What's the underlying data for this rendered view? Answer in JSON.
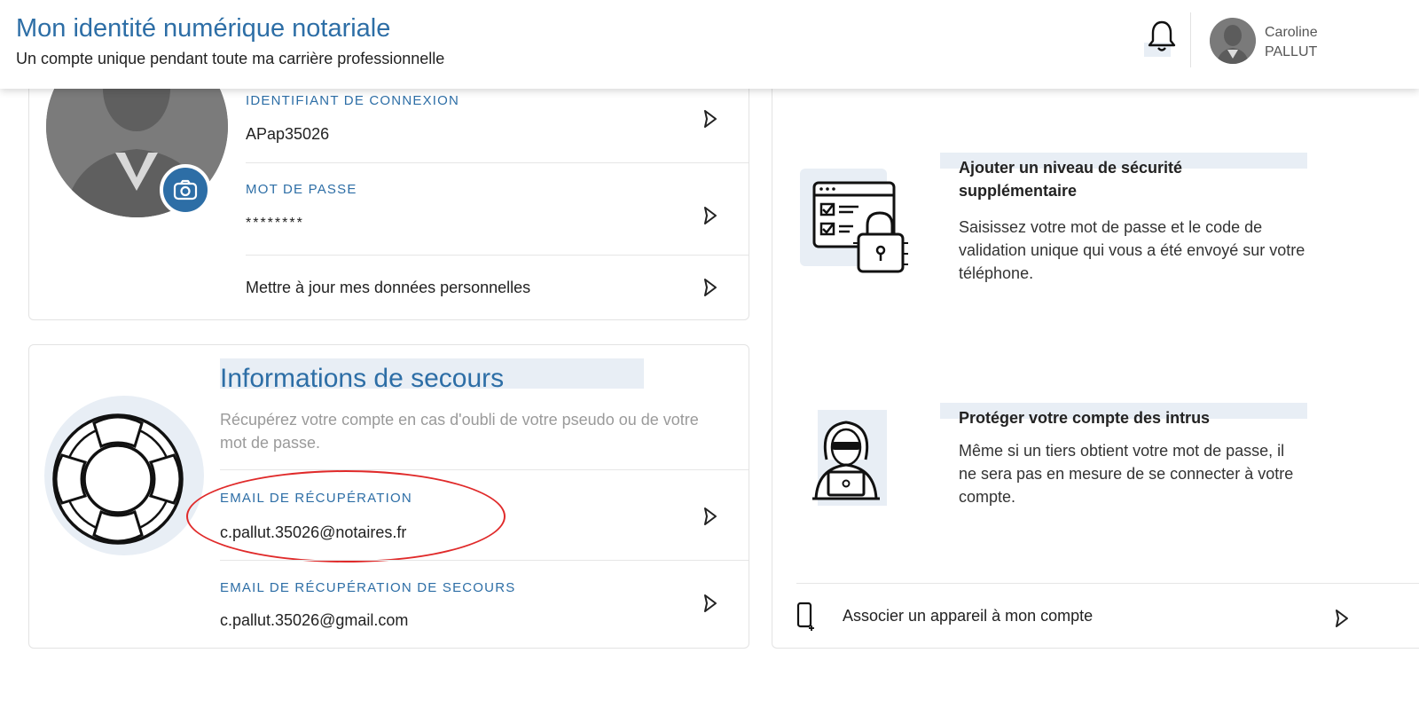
{
  "header": {
    "title": "Mon identité numérique notariale",
    "subtitle": "Un compte unique pendant toute ma carrière professionnelle",
    "user_first_name": "Caroline",
    "user_last_name": "PALLUT"
  },
  "account": {
    "login_label": "IDENTIFIANT DE CONNEXION",
    "login_value": "APap35026",
    "password_label": "MOT DE PASSE",
    "password_value": "********",
    "update_label": "Mettre à jour mes données personnelles"
  },
  "rescue": {
    "title": "Informations de secours",
    "description": "Récupérez votre compte en cas d'oubli de votre pseudo ou de votre mot de passe.",
    "recovery_email_label": "EMAIL DE RÉCUPÉRATION",
    "recovery_email_value": "c.pallut.35026@notaires.fr",
    "backup_email_label": "EMAIL DE RÉCUPÉRATION DE SECOURS",
    "backup_email_value": "c.pallut.35026@gmail.com"
  },
  "security": {
    "feature1_title": "Ajouter un niveau de sécurité supplémentaire",
    "feature1_text": "Saisissez votre mot de passe et le code de validation unique qui vous a été envoyé sur votre téléphone.",
    "feature2_title": "Protéger votre compte des intrus",
    "feature2_text": "Même si un tiers obtient votre mot de passe, il ne sera pas en mesure de se connecter à votre compte.",
    "associate_device_label": "Associer un appareil à mon compte"
  },
  "colors": {
    "accent": "#2d6ea6",
    "highlight_bg": "#e8eef5",
    "annotation_red": "#e02a2a"
  }
}
